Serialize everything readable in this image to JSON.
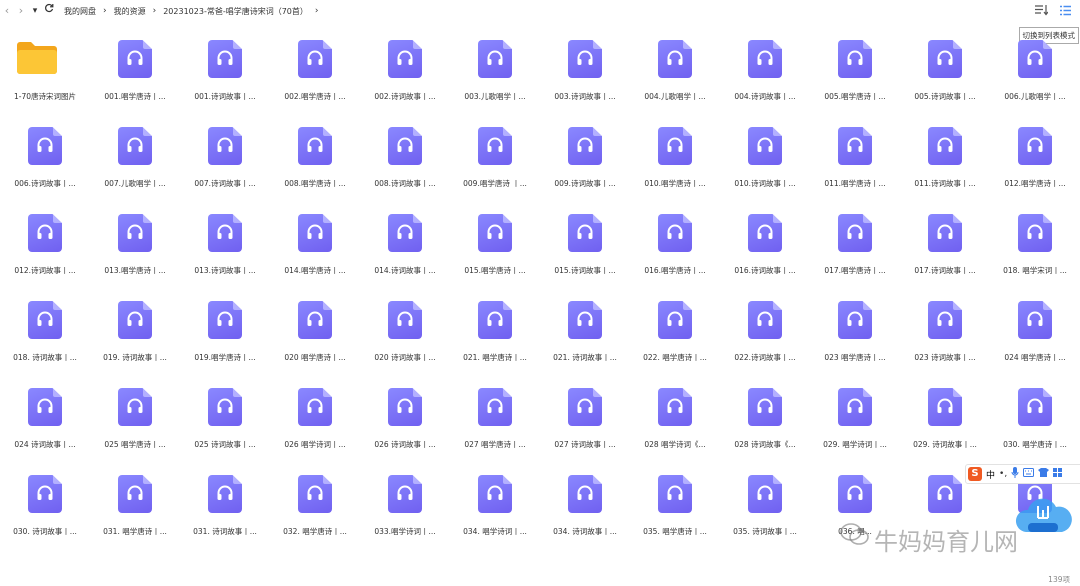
{
  "breadcrumb": {
    "items": [
      "我的网盘",
      "我的资源",
      "20231023-常爸-唱学唐诗宋词（70首）"
    ]
  },
  "tooltip": "切换到列表模式",
  "folder": {
    "label": "1-70唐诗宋词图片"
  },
  "files": [
    "001.唱学唐诗丨...",
    "001.诗词故事丨...",
    "002.唱学唐诗丨...",
    "002.诗词故事丨...",
    "003.儿歌唱学丨...",
    "003.诗词故事丨...",
    "004.儿歌唱学丨...",
    "004.诗词故事丨...",
    "005.唱学唐诗丨...",
    "005.诗词故事丨...",
    "006.儿歌唱学丨...",
    "006.诗词故事丨...",
    "007.儿歌唱学丨...",
    "007.诗词故事丨...",
    "008.唱学唐诗丨...",
    "008.诗词故事丨...",
    "009.唱学唐诗 丨...",
    "009.诗词故事丨...",
    "010.唱学唐诗丨...",
    "010.诗词故事丨...",
    "011.唱学唐诗丨...",
    "011.诗词故事丨...",
    "012.唱学唐诗丨...",
    "012.诗词故事丨...",
    "013.唱学唐诗丨...",
    "013.诗词故事丨...",
    "014.唱学唐诗丨...",
    "014.诗词故事丨...",
    "015.唱学唐诗丨...",
    "015.诗词故事丨...",
    "016.唱学唐诗丨...",
    "016.诗词故事丨...",
    "017.唱学唐诗丨...",
    "017.诗词故事丨...",
    "018. 唱学宋词丨...",
    "018. 诗词故事丨...",
    "019. 诗词故事丨...",
    "019.唱学唐诗丨...",
    "020 唱学唐诗丨...",
    "020 诗词故事丨...",
    "021. 唱学唐诗丨...",
    "021. 诗词故事丨...",
    "022. 唱学唐诗丨...",
    "022.诗词故事丨...",
    "023 唱学唐诗丨...",
    "023 诗词故事丨...",
    "024 唱学唐诗丨...",
    "024 诗词故事丨...",
    "025 唱学唐诗丨...",
    "025 诗词故事丨...",
    "026 唱学诗词丨...",
    "026 诗词故事丨...",
    "027 唱学唐诗丨...",
    "027 诗词故事丨...",
    "028 唱学诗词《...",
    "028 诗词故事《...",
    "029. 唱学诗词丨...",
    "029. 诗词故事丨...",
    "030. 唱学唐诗丨...",
    "030. 诗词故事丨...",
    "031. 唱学唐诗丨...",
    "031. 诗词故事丨...",
    "032. 唱学唐诗丨...",
    "033.唱学诗词丨...",
    "034. 唱学诗词丨...",
    "034. 诗词故事丨...",
    "035. 唱学唐诗丨...",
    "035. 诗词故事丨...",
    "036. 唱...",
    "",
    ""
  ],
  "status": {
    "count": "139项"
  },
  "ime": {
    "lang": "中"
  },
  "watermark": {
    "text": "牛妈妈育儿网"
  },
  "colors": {
    "file_icon": "#7b6cf6",
    "folder": "#fbbd2b",
    "text": "#333333"
  },
  "icons": {
    "back": "chevron-left-icon",
    "forward": "chevron-right-icon",
    "refresh": "refresh-icon",
    "sort": "sort-icon",
    "view": "list-view-icon",
    "file": "headphones-icon"
  }
}
